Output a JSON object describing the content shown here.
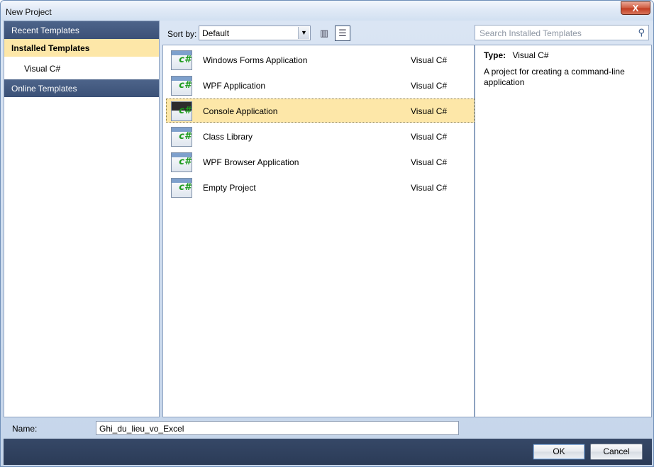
{
  "window": {
    "title": "New Project",
    "close_glyph": "X"
  },
  "left": {
    "items": [
      {
        "label": "Recent Templates",
        "kind": "dark"
      },
      {
        "label": "Installed Templates",
        "kind": "selected"
      },
      {
        "label": "Visual C#",
        "kind": "sub"
      },
      {
        "label": "Online Templates",
        "kind": "dark"
      }
    ]
  },
  "toolbar": {
    "sort_label": "Sort by:",
    "sort_value": "Default",
    "view_small_icon": "small-icons-view-icon",
    "view_list_icon": "list-view-icon"
  },
  "search": {
    "placeholder": "Search Installed Templates",
    "icon": "search-icon"
  },
  "templates": [
    {
      "name": "Windows Forms Application",
      "lang": "Visual C#"
    },
    {
      "name": "WPF Application",
      "lang": "Visual C#"
    },
    {
      "name": "Console Application",
      "lang": "Visual C#",
      "selected": true
    },
    {
      "name": "Class Library",
      "lang": "Visual C#"
    },
    {
      "name": "WPF Browser Application",
      "lang": "Visual C#"
    },
    {
      "name": "Empty Project",
      "lang": "Visual C#"
    }
  ],
  "details": {
    "type_label": "Type:",
    "type_value": "Visual C#",
    "description": "A project for creating a command-line application"
  },
  "footer": {
    "name_label": "Name:",
    "name_value": "Ghi_du_lieu_vo_Excel",
    "ok_label": "OK",
    "cancel_label": "Cancel"
  },
  "icon_glyph": "c#"
}
